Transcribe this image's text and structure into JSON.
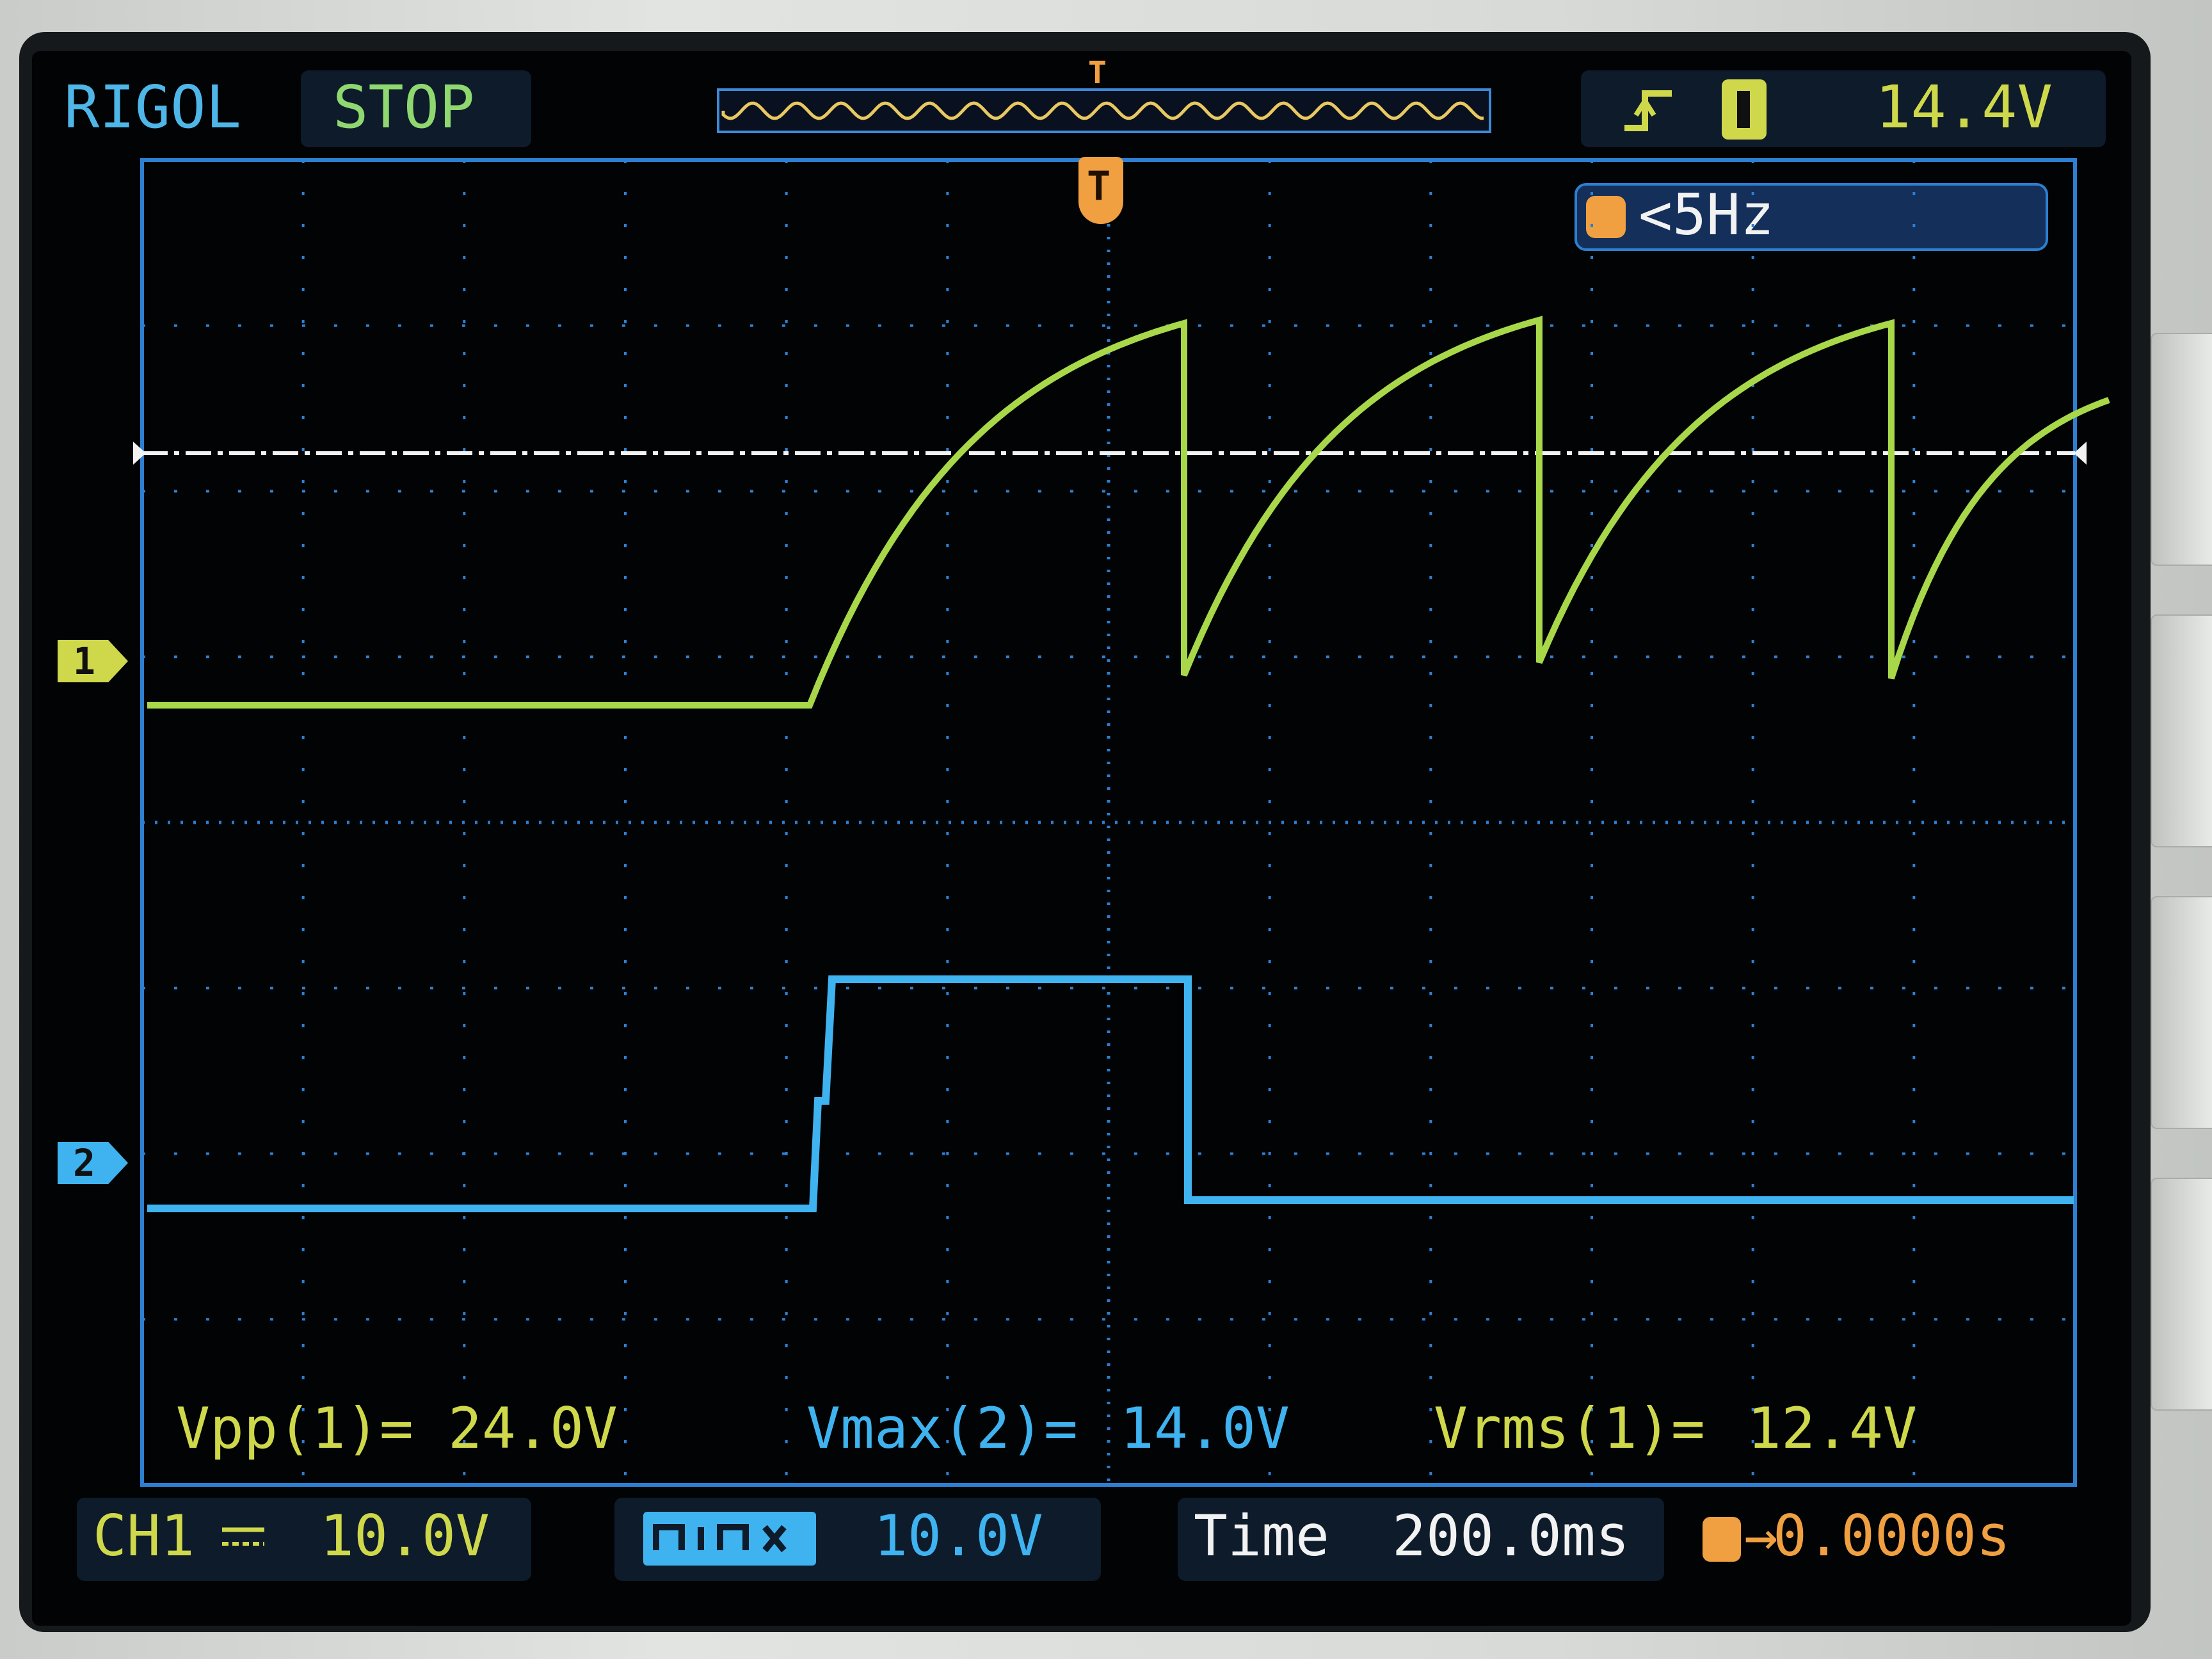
{
  "header": {
    "brand": "RIGOL",
    "run_state": "STOP",
    "trigger_level": "14.4V"
  },
  "trigger_popup": {
    "label": "<5Hz"
  },
  "markers": {
    "ch1": "1",
    "ch2": "2",
    "trigger_position": "T"
  },
  "measurements": [
    {
      "label": "Vpp(1)=",
      "value": "24.0V"
    },
    {
      "label": "Vmax(2)=",
      "value": "14.0V"
    },
    {
      "label": "Vrms(1)=",
      "value": "12.4V"
    }
  ],
  "footer": {
    "ch1_label": "CH1",
    "ch1_scale": "10.0V",
    "ch2_scale": "10.0V",
    "time_label": "Time",
    "time_scale": "200.0ms",
    "trigger_offset": "0.0000s"
  },
  "colors": {
    "ch1": "#a8d84a",
    "ch2": "#3fb3f0",
    "trigger": "#f0a040",
    "brand": "#4fb6e8",
    "grid": "#2d7fd0",
    "text_yellow": "#cfd84a",
    "text_white": "#f2f2f2"
  },
  "icons": {
    "trigger_edge": "rising-edge-icon",
    "trigger_channel": "channel-1-icon",
    "ch1_coupling": "dc-coupling-icon",
    "ch2_channel": "channel-2-icon"
  }
}
